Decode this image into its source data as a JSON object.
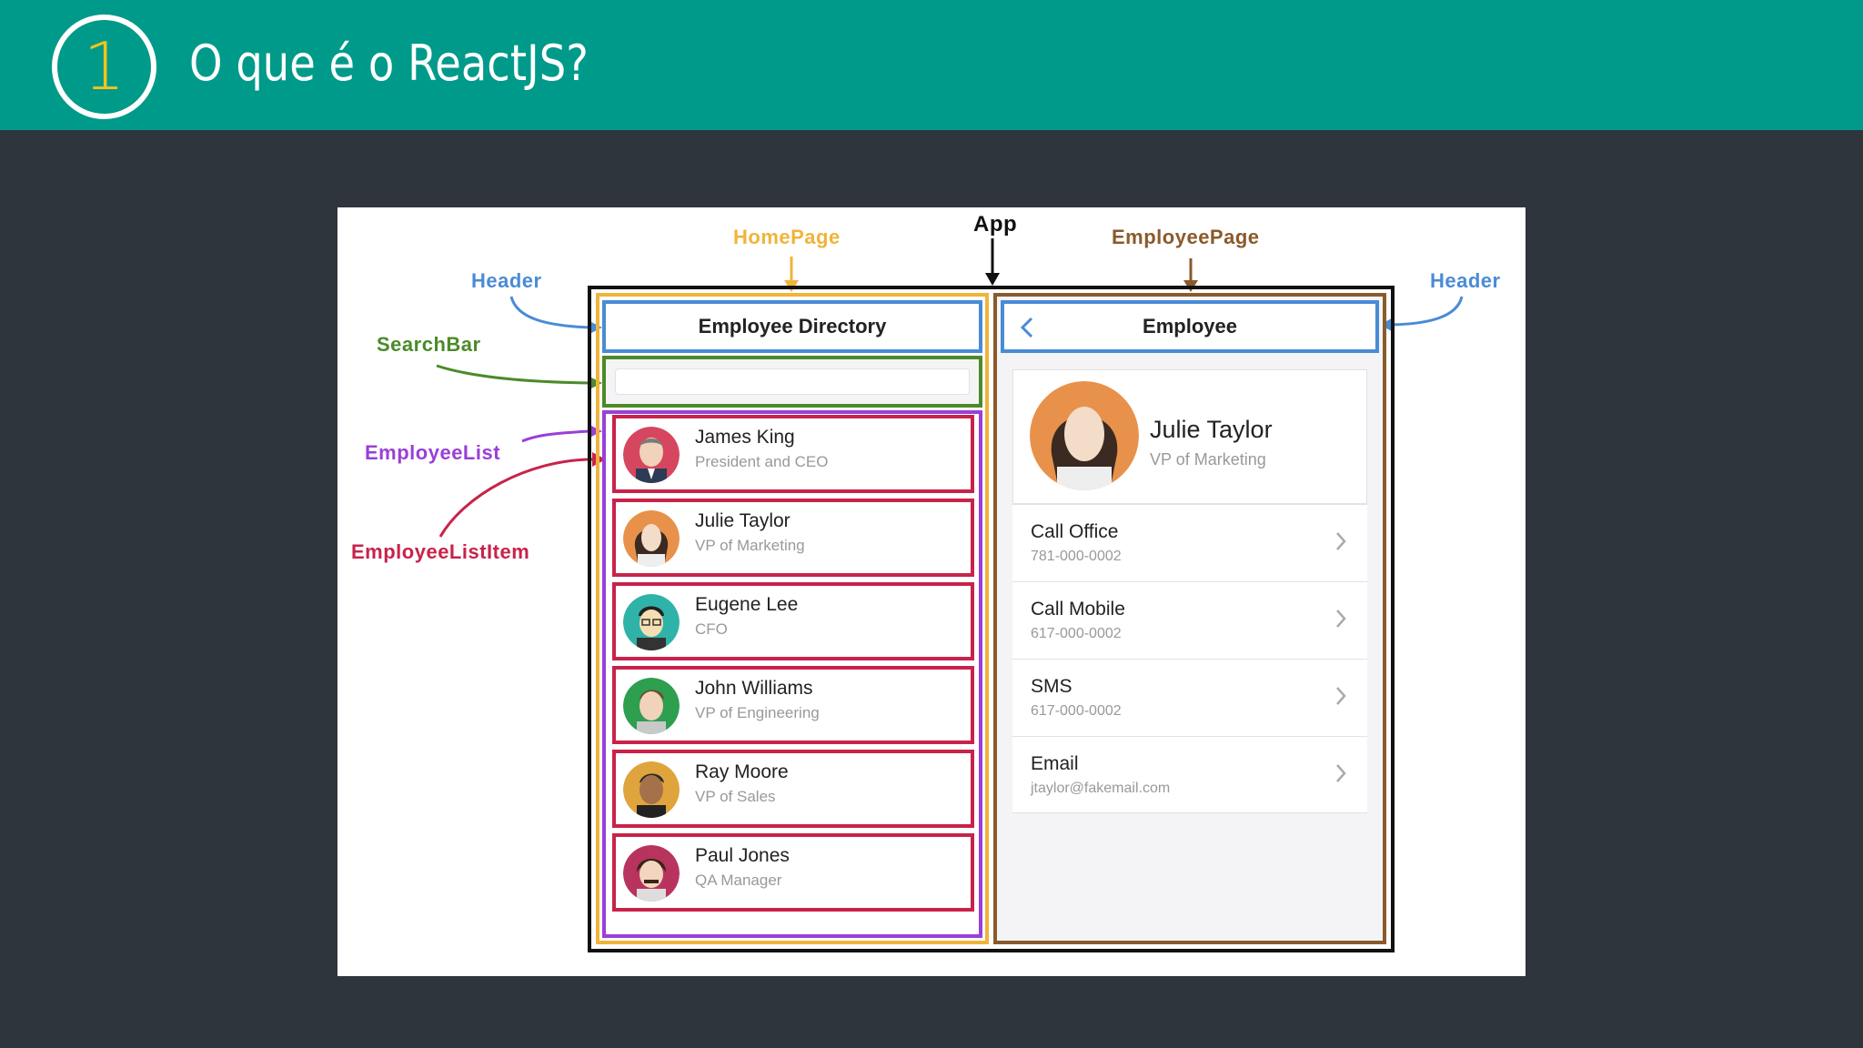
{
  "slide": {
    "number": "1",
    "title": "O que é o ReactJS?"
  },
  "annotations": {
    "app": "App",
    "home_page": "HomePage",
    "employee_page": "EmployeePage",
    "header_left": "Header",
    "header_right": "Header",
    "search_bar": "SearchBar",
    "employee_list": "EmployeeList",
    "employee_list_item": "EmployeeListItem"
  },
  "home": {
    "header_title": "Employee Directory",
    "search_value": "",
    "employees": [
      {
        "name": "James King",
        "title": "President and CEO"
      },
      {
        "name": "Julie Taylor",
        "title": "VP of Marketing"
      },
      {
        "name": "Eugene Lee",
        "title": "CFO"
      },
      {
        "name": "John Williams",
        "title": "VP of Engineering"
      },
      {
        "name": "Ray Moore",
        "title": "VP of Sales"
      },
      {
        "name": "Paul Jones",
        "title": "QA Manager"
      }
    ]
  },
  "employee": {
    "header_title": "Employee",
    "back_icon": "chevron-left-icon",
    "name": "Julie Taylor",
    "title": "VP of Marketing",
    "actions": [
      {
        "label": "Call Office",
        "value": "781-000-0002"
      },
      {
        "label": "Call Mobile",
        "value": "617-000-0002"
      },
      {
        "label": "SMS",
        "value": "617-000-0002"
      },
      {
        "label": "Email",
        "value": "jtaylor@fakemail.com"
      }
    ]
  },
  "colors": {
    "topbar": "#009a8a",
    "background": "#2f353d",
    "number": "#f2c41a",
    "app_frame": "#111111",
    "home_page": "#f0b43a",
    "employee_page": "#8a5a2b",
    "header": "#4a8bd6",
    "search_bar": "#4c8a2a",
    "employee_list": "#9b3fd6",
    "employee_list_item": "#c8234a"
  }
}
